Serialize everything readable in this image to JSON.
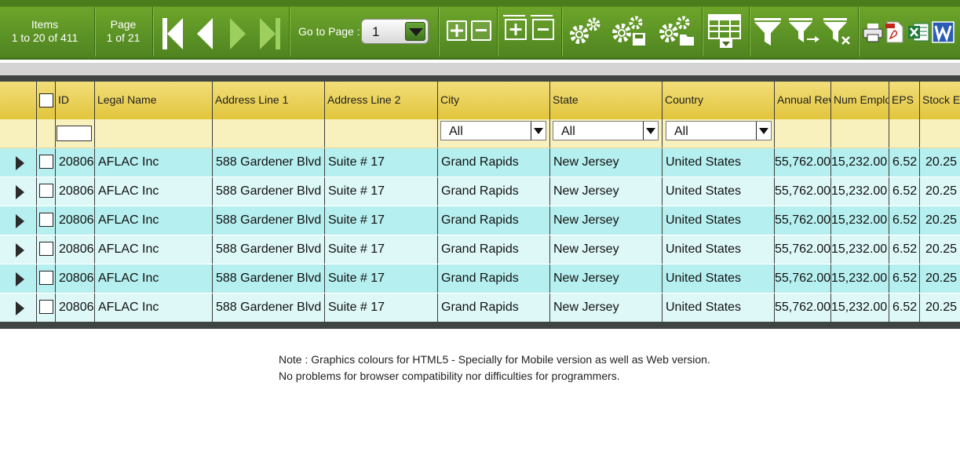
{
  "pager": {
    "items_title": "Items",
    "items_range": "1 to 20 of 411",
    "page_title": "Page",
    "page_range": "1 of 21",
    "goto_label": "Go to Page :",
    "goto_value": "1"
  },
  "toolbar_icons": [
    "first-page-icon",
    "previous-page-icon",
    "next-page-icon",
    "last-page-icon",
    "add-icon",
    "remove-icon",
    "expand-all-icon",
    "collapse-all-icon",
    "settings-icon",
    "save-settings-icon",
    "load-settings-icon",
    "column-chooser-icon",
    "filter-icon",
    "apply-filter-icon",
    "clear-filter-icon",
    "print-icon",
    "export-pdf-icon",
    "export-excel-icon",
    "export-word-icon"
  ],
  "columns": {
    "id": "ID",
    "legal_name": "Legal Name",
    "address1": "Address Line 1",
    "address2": "Address Line 2",
    "city": "City",
    "state": "State",
    "country": "Country",
    "annual_rev": "Annual Rev",
    "num_employ": "Num Employ",
    "eps": "EPS",
    "stock_ex": "Stock Ex"
  },
  "filters": {
    "city": "All",
    "state": "All",
    "country": "All"
  },
  "rows": [
    {
      "id": "20806",
      "legal_name": "AFLAC Inc",
      "address1": "588 Gardener Blvd",
      "address2": "Suite # 17",
      "city": "Grand Rapids",
      "state": "New Jersey",
      "country": "United States",
      "annual_rev": "55,762.00",
      "num_employ": "15,232.00",
      "eps": "6.52",
      "stock_ex": "20.25"
    },
    {
      "id": "20806",
      "legal_name": "AFLAC Inc",
      "address1": "588 Gardener Blvd",
      "address2": "Suite # 17",
      "city": "Grand Rapids",
      "state": "New Jersey",
      "country": "United States",
      "annual_rev": "55,762.00",
      "num_employ": "15,232.00",
      "eps": "6.52",
      "stock_ex": "20.25"
    },
    {
      "id": "20806",
      "legal_name": "AFLAC Inc",
      "address1": "588 Gardener Blvd",
      "address2": "Suite # 17",
      "city": "Grand Rapids",
      "state": "New Jersey",
      "country": "United States",
      "annual_rev": "55,762.00",
      "num_employ": "15,232.00",
      "eps": "6.52",
      "stock_ex": "20.25"
    },
    {
      "id": "20806",
      "legal_name": "AFLAC Inc",
      "address1": "588 Gardener Blvd",
      "address2": "Suite # 17",
      "city": "Grand Rapids",
      "state": "New Jersey",
      "country": "United States",
      "annual_rev": "55,762.00",
      "num_employ": "15,232.00",
      "eps": "6.52",
      "stock_ex": "20.25"
    },
    {
      "id": "20806",
      "legal_name": "AFLAC Inc",
      "address1": "588 Gardener Blvd",
      "address2": "Suite # 17",
      "city": "Grand Rapids",
      "state": "New Jersey",
      "country": "United States",
      "annual_rev": "55,762.00",
      "num_employ": "15,232.00",
      "eps": "6.52",
      "stock_ex": "20.25"
    },
    {
      "id": "20806",
      "legal_name": "AFLAC Inc",
      "address1": "588 Gardener Blvd",
      "address2": "Suite # 17",
      "city": "Grand Rapids",
      "state": "New Jersey",
      "country": "United States",
      "annual_rev": "55,762.00",
      "num_employ": "15,232.00",
      "eps": "6.52",
      "stock_ex": "20.25"
    }
  ],
  "note": {
    "line1": "Note : Graphics colours for HTML5 - Specially for Mobile version as well as Web version.",
    "line2": "No problems for browser compatibility nor difficulties for programmers."
  },
  "colors": {
    "toolbar_green": "#5e9526",
    "header_gold": "#e2c53c",
    "filter_cream": "#f8f0bd",
    "row_teal": "#b6efef",
    "row_light": "#def8f8"
  }
}
